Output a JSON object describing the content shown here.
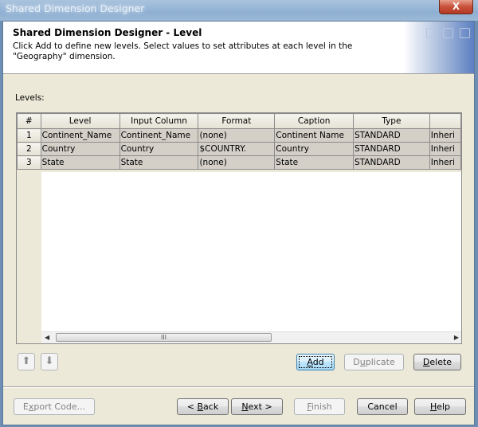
{
  "window": {
    "title": "Shared Dimension Designer",
    "close_label": "X"
  },
  "header": {
    "title": "Shared Dimension Designer - Level",
    "description": "Click Add to define new levels. Select values to set attributes at each level in the \"Geography\" dimension."
  },
  "levels_label": "Levels:",
  "table": {
    "columns": [
      "#",
      "Level",
      "Input Column",
      "Format",
      "Caption",
      "Type",
      ""
    ],
    "rows": [
      {
        "num": "1",
        "level": "Continent_Name",
        "input_column": "Continent_Name",
        "format": "(none)",
        "caption": "Continent Name",
        "type": "STANDARD",
        "extra": "Inheri"
      },
      {
        "num": "2",
        "level": "Country",
        "input_column": "Country",
        "format": "$COUNTRY.",
        "caption": "Country",
        "type": "STANDARD",
        "extra": "Inheri"
      },
      {
        "num": "3",
        "level": "State",
        "input_column": "State",
        "format": "(none)",
        "caption": "State",
        "type": "STANDARD",
        "extra": "Inheri"
      }
    ],
    "scroll_grip": "III"
  },
  "icons": {
    "move_up": "↑ arrow-up",
    "move_down": "↓ arrow-down"
  },
  "buttons": {
    "add": {
      "pre": "",
      "u": "A",
      "post": "dd"
    },
    "duplicate": {
      "pre": "D",
      "u": "u",
      "post": "plicate"
    },
    "delete": {
      "pre": "",
      "u": "D",
      "post": "elete"
    },
    "export_code": {
      "pre": "E",
      "u": "x",
      "post": "port Code..."
    },
    "back": {
      "pre": "< ",
      "u": "B",
      "post": "ack"
    },
    "next": {
      "pre": "",
      "u": "N",
      "post": "ext >"
    },
    "finish": {
      "pre": "",
      "u": "F",
      "post": "inish"
    },
    "cancel": {
      "pre": "Cancel",
      "u": "",
      "post": ""
    },
    "help": {
      "pre": "",
      "u": "H",
      "post": "elp"
    }
  }
}
